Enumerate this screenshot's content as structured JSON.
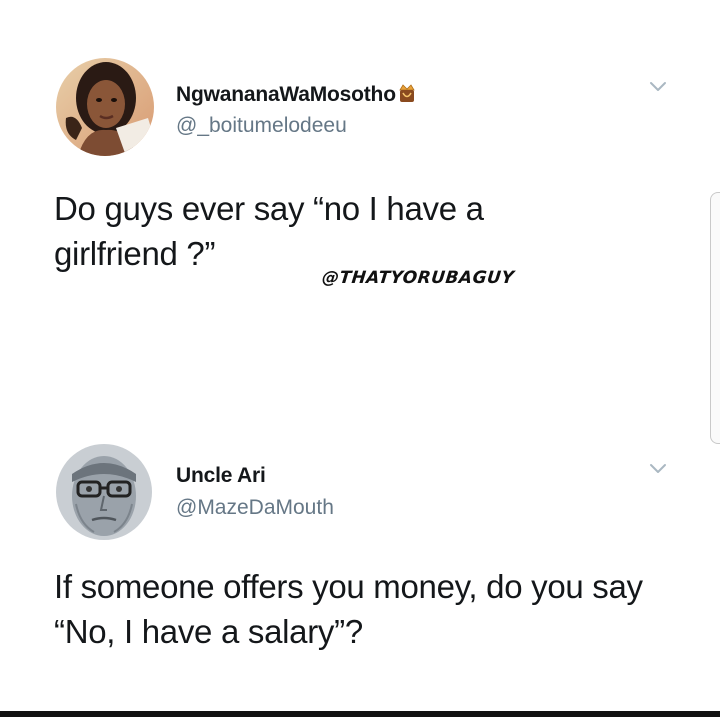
{
  "tweets": [
    {
      "display_name": "NgwananaWaMosotho",
      "handle": "@_boitumelodeeu",
      "text": "Do guys ever say “no I have a girlfriend ?”",
      "avatar": "profile-photo-woman",
      "badge_icon": "crown-emoji-icon"
    },
    {
      "display_name": "Uncle Ari",
      "handle": "@MazeDaMouth",
      "text": "If someone offers you money, do you say “No, I have a salary”?",
      "avatar": "profile-photo-man-glasses"
    }
  ],
  "watermark": "@THATYORUBAGUY",
  "colors": {
    "text": "#14171a",
    "handle": "#657786",
    "chevron": "#aab8c2"
  }
}
